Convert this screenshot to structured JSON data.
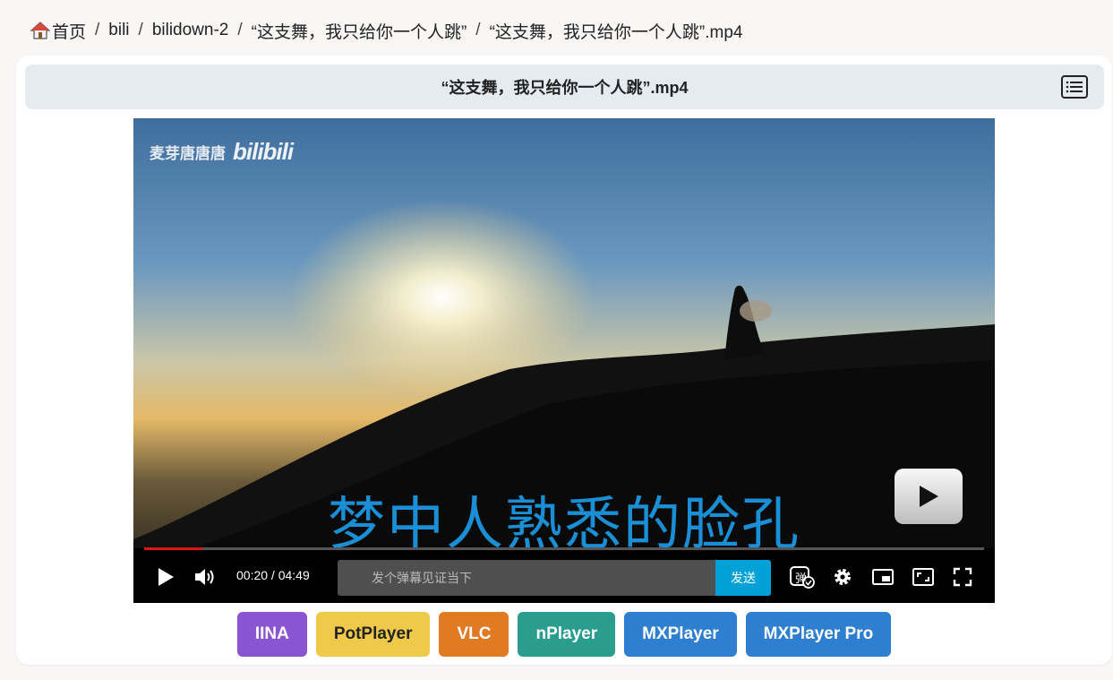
{
  "breadcrumb": {
    "home_label": "首页",
    "items": [
      "bili",
      "bilidown-2",
      "“这支舞，我只给你一个人跳”",
      "“这支舞，我只给你一个人跳”.mp4"
    ],
    "separator": "/"
  },
  "file": {
    "title": "“这支舞，我只给你一个人跳”.mp4"
  },
  "player": {
    "watermark_name": "麦芽唐唐唐",
    "watermark_logo": "bilibili",
    "subtitle": "梦中人熟悉的脸孔",
    "current_time": "00:20",
    "duration": "04:49",
    "time_display": "00:20 / 04:49",
    "progress": 0.069,
    "danmaku_placeholder": "发个弹幕见证当下",
    "send_label": "发送",
    "danmaku_toggle_label": "弹"
  },
  "external_players": [
    {
      "label": "IINA",
      "color": "#8a55d0"
    },
    {
      "label": "PotPlayer",
      "color": "#efc94a"
    },
    {
      "label": "VLC",
      "color": "#e07a23"
    },
    {
      "label": "nPlayer",
      "color": "#2a9d8f"
    },
    {
      "label": "MXPlayer",
      "color": "#2e7fcf"
    },
    {
      "label": "MXPlayer Pro",
      "color": "#2e7fcf"
    }
  ]
}
